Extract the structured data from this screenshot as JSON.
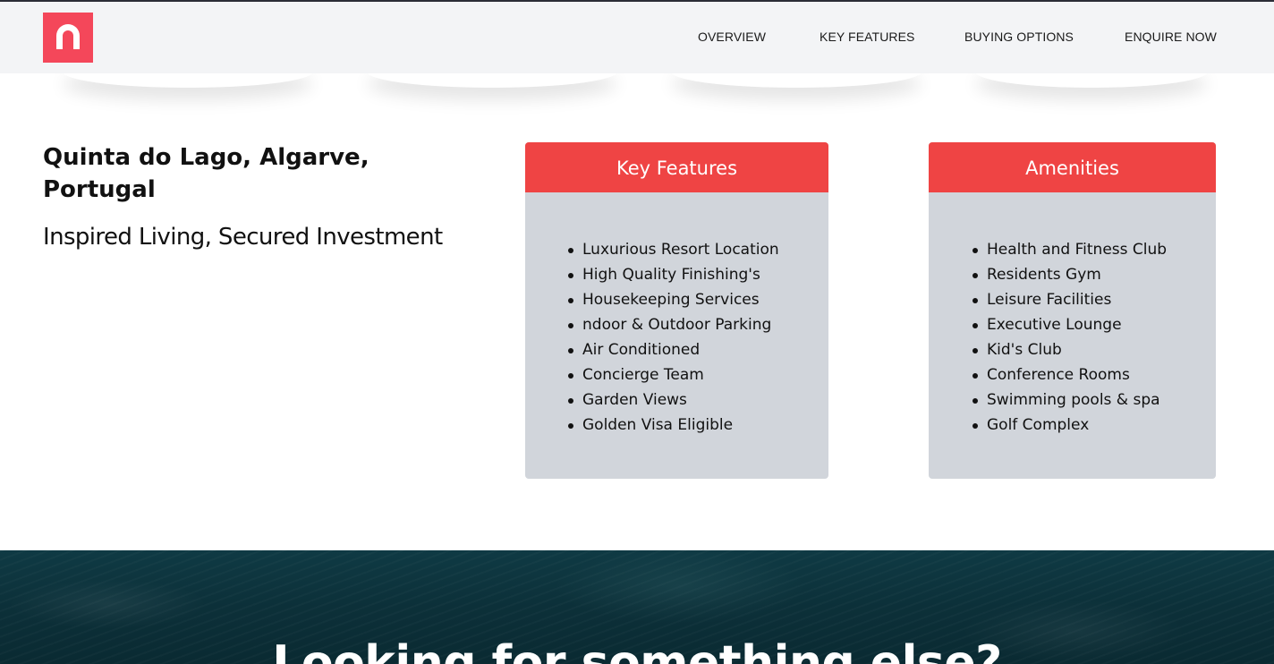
{
  "header": {
    "logo_icon": "n-logo-icon",
    "brand_color": "#f4475a",
    "nav": [
      "OVERVIEW",
      "KEY FEATURES",
      "BUYING OPTIONS",
      "ENQUIRE NOW"
    ]
  },
  "property": {
    "location": "Quinta do Lago, Algarve, Portugal",
    "tagline": "Inspired Living, Secured Investment"
  },
  "key_features": {
    "title": "Key Features",
    "items": [
      "Luxurious Resort Location",
      "High Quality Finishing's",
      "Housekeeping Services",
      "ndoor & Outdoor Parking",
      "Air Conditioned",
      "Concierge Team",
      "Garden Views",
      "Golden Visa Eligible"
    ]
  },
  "amenities": {
    "title": "Amenities",
    "items": [
      "Health and Fitness Club",
      "Residents Gym",
      "Leisure Facilities",
      "Executive Lounge",
      "Kid's Club",
      "Conference Rooms",
      "Swimming pools & spa",
      "Golf Complex"
    ]
  },
  "cta": {
    "heading": "Looking for something else?"
  },
  "colors": {
    "card_header": "#ef4444",
    "card_body": "#d1d5db",
    "header_bg": "#f3f4f6"
  }
}
